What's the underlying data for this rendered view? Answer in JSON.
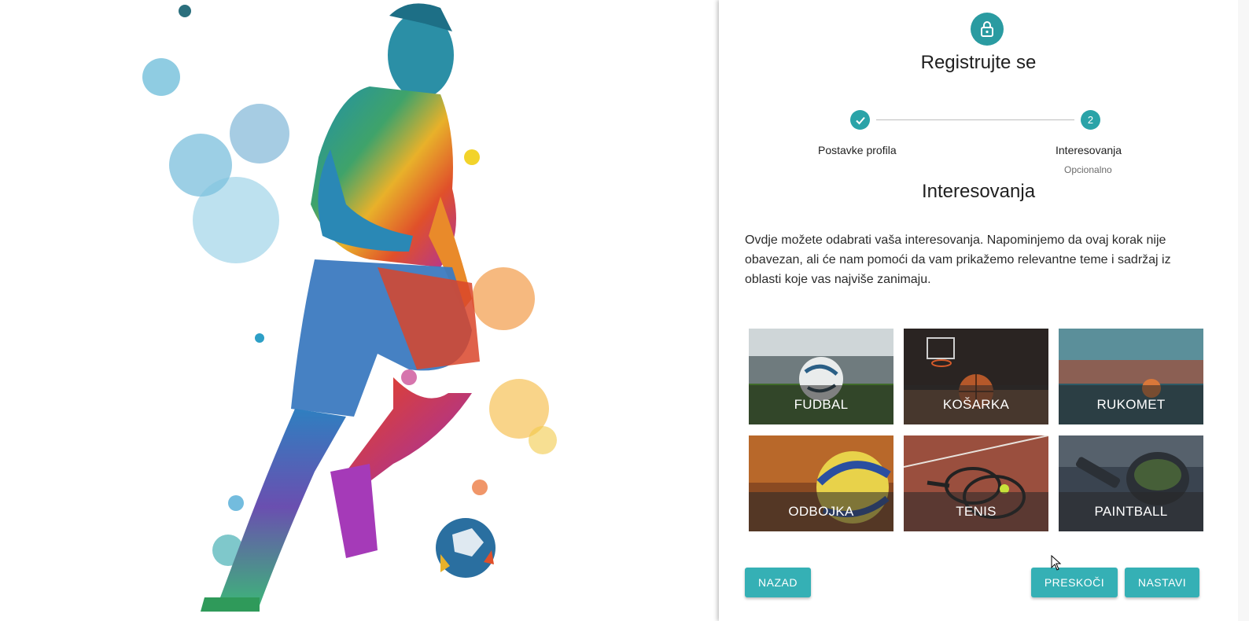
{
  "hero": {
    "image": "soccer-player-watercolor"
  },
  "panel": {
    "icon": "lock-icon",
    "title": "Registrujte se",
    "stepper": {
      "steps": [
        {
          "label": "Postavke profila",
          "state": "completed",
          "icon": "check-icon"
        },
        {
          "number": "2",
          "label": "Interesovanja",
          "sublabel": "Opcionalno",
          "state": "active"
        }
      ]
    },
    "section_title": "Interesovanja",
    "description": "Ovdje možete odabrati vaša interesovanja. Napominjemo da ovaj korak nije obavezan, ali će nam pomoći da vam prikažemo relevantne teme i sadržaj iz oblasti koje vas najviše zanimaju.",
    "interests": [
      {
        "label": "FUDBAL"
      },
      {
        "label": "KOŠARKA"
      },
      {
        "label": "RUKOMET"
      },
      {
        "label": "ODBOJKA"
      },
      {
        "label": "TENIS"
      },
      {
        "label": "PAINTBALL"
      }
    ],
    "buttons": {
      "back": "NAZAD",
      "skip": "PRESKOČI",
      "next": "NASTAVI"
    }
  },
  "colors": {
    "accent": "#2a9ba1",
    "button": "#35b0b5"
  }
}
